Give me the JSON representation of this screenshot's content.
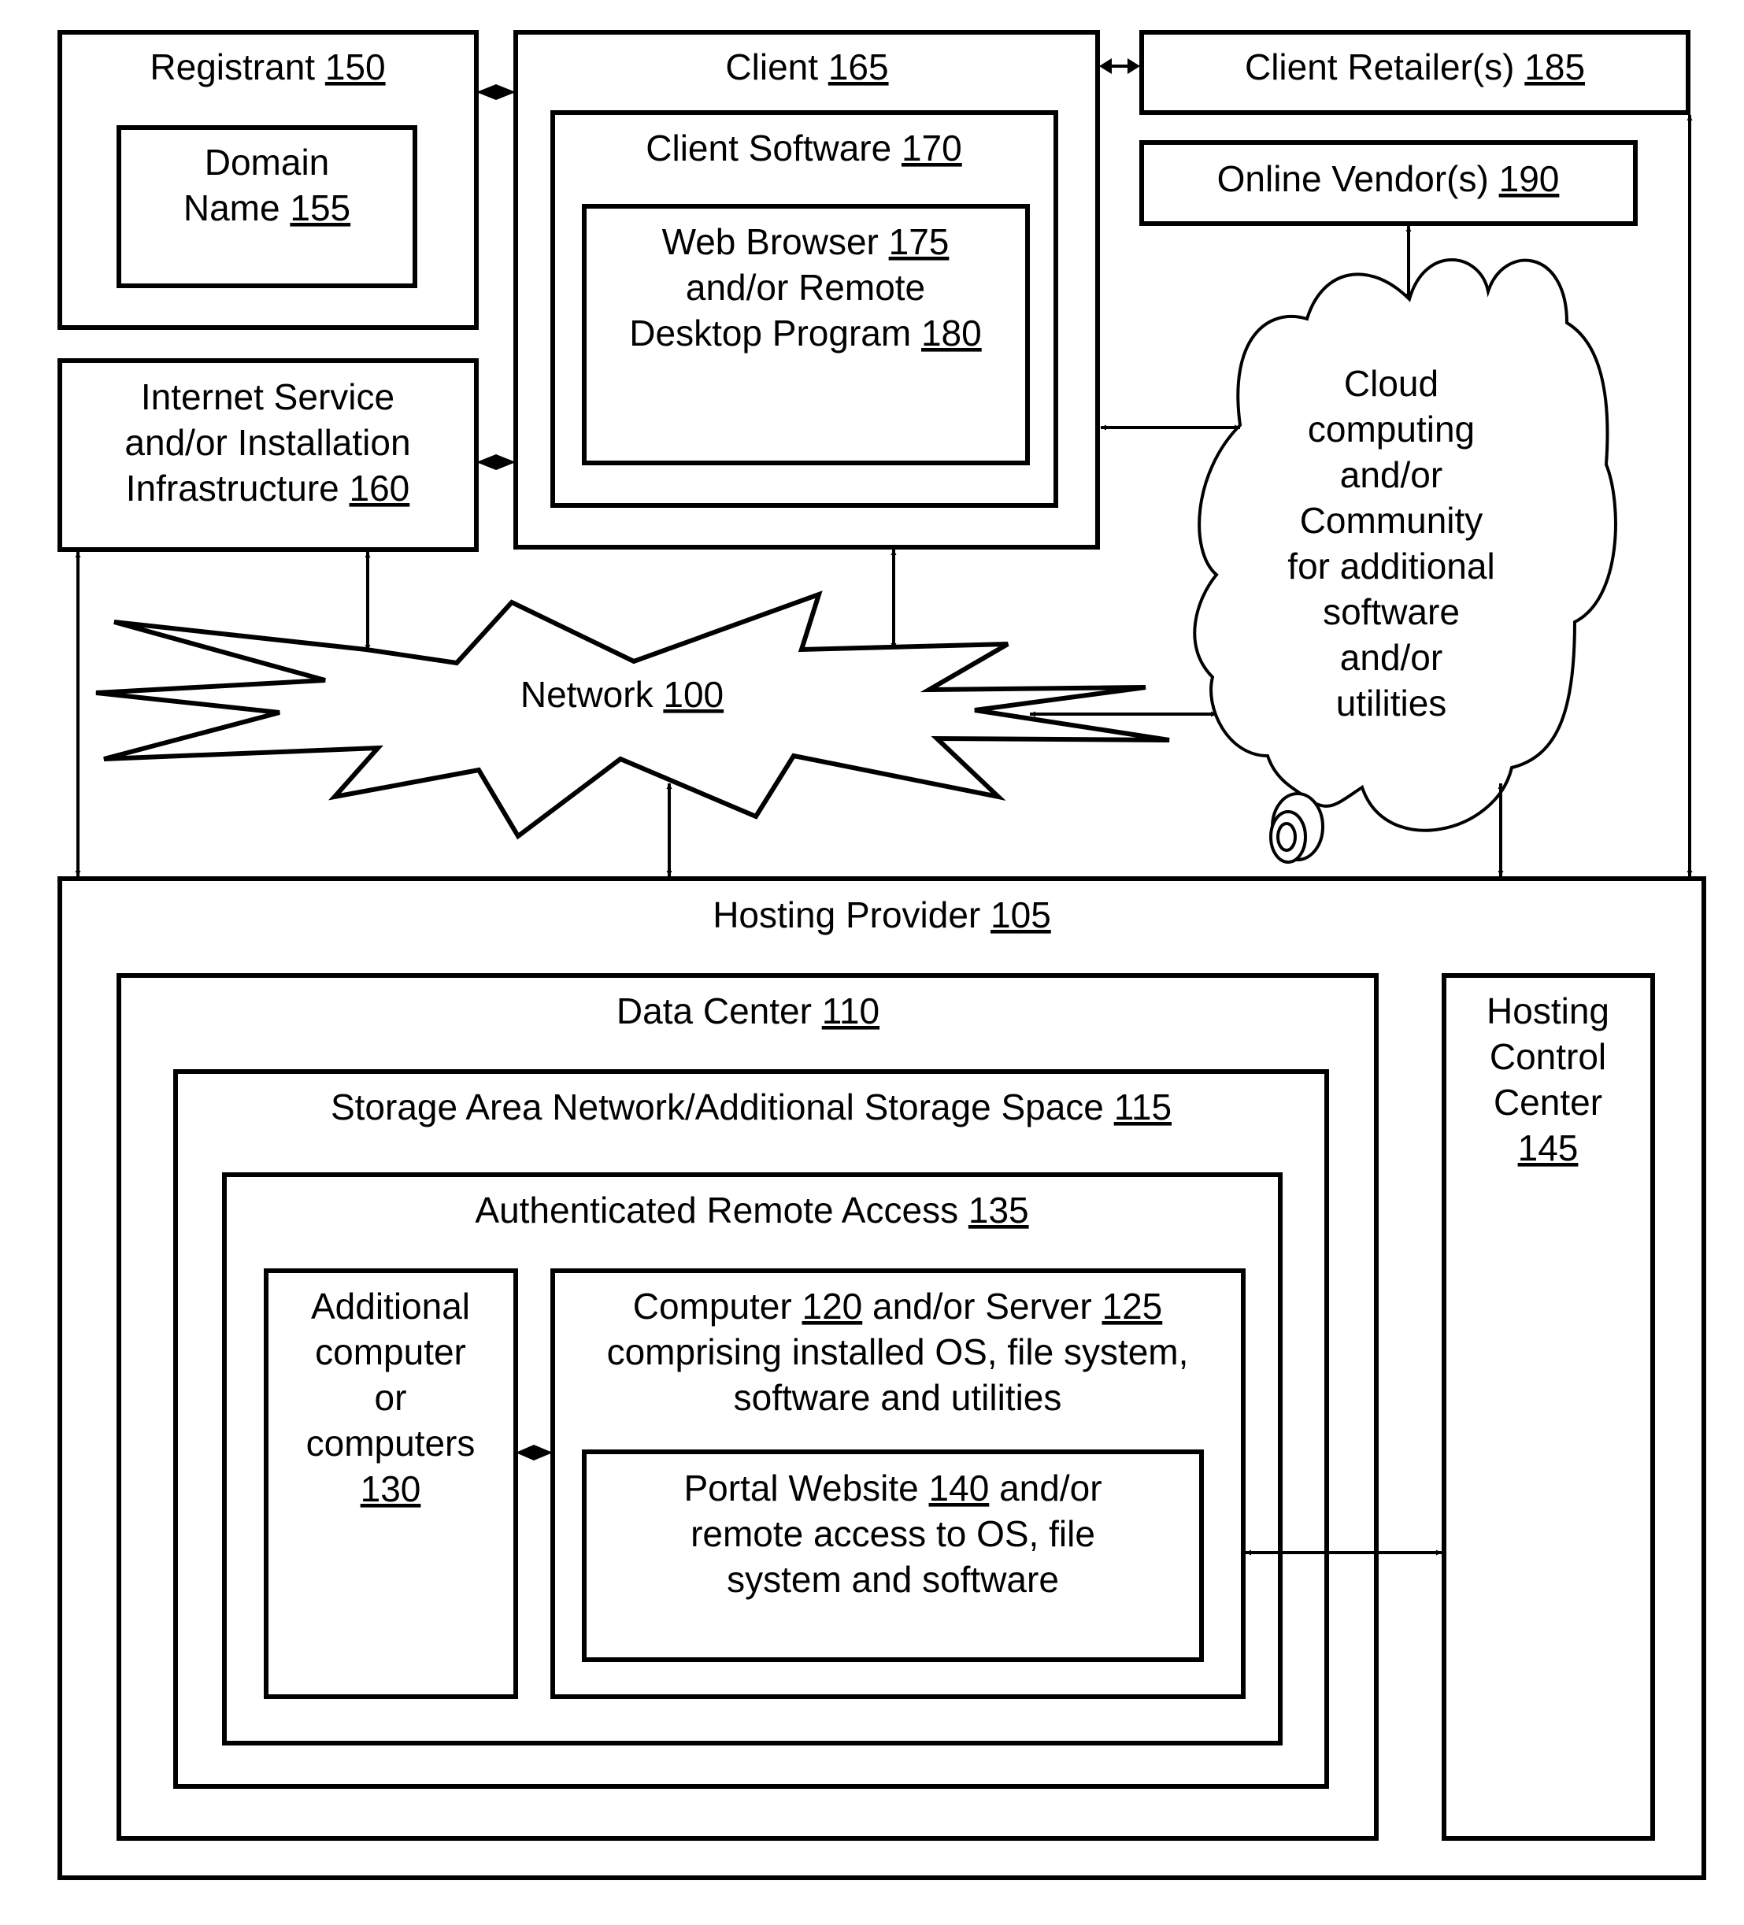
{
  "diagram": {
    "registrant": {
      "label": "Registrant",
      "ref": "150"
    },
    "domain_name": {
      "line1": "Domain",
      "label": "Name",
      "ref": "155"
    },
    "isp": {
      "line1": "Internet Service",
      "line2": "and/or Installation",
      "label": "Infrastructure",
      "ref": "160"
    },
    "client": {
      "label": "Client",
      "ref": "165"
    },
    "client_software": {
      "label": "Client Software",
      "ref": "170"
    },
    "web_browser": {
      "label": "Web Browser",
      "ref": "175",
      "line2": "and/or Remote",
      "label3": "Desktop Program",
      "ref3": "180"
    },
    "client_retailer": {
      "label": "Client Retailer(s)",
      "ref": "185"
    },
    "online_vendor": {
      "label": "Online Vendor(s)",
      "ref": "190"
    },
    "cloud": {
      "lines": [
        "Cloud",
        "computing",
        "and/or",
        "Community",
        "for additional",
        "software",
        "and/or",
        "utilities"
      ]
    },
    "network": {
      "label": "Network",
      "ref": "100"
    },
    "hosting_provider": {
      "label": "Hosting Provider",
      "ref": "105"
    },
    "data_center": {
      "label": "Data Center",
      "ref": "110"
    },
    "san": {
      "label": "Storage Area Network/Additional Storage Space",
      "ref": "115"
    },
    "ara": {
      "label": "Authenticated Remote Access",
      "ref": "135"
    },
    "additional": {
      "lines": [
        "Additional",
        "computer",
        "or",
        "computers"
      ],
      "ref": "130"
    },
    "computer": {
      "label1": "Computer",
      "ref1": "120",
      "mid": "and/or Server",
      "ref2": "125",
      "line2": "comprising installed OS, file system,",
      "line3": "software and utilities"
    },
    "portal": {
      "label": "Portal Website",
      "ref": "140",
      "tail": "and/or",
      "line2": "remote access to OS, file",
      "line3": "system and software"
    },
    "hosting_control": {
      "lines": [
        "Hosting",
        "Control",
        "Center"
      ],
      "ref": "145"
    }
  }
}
